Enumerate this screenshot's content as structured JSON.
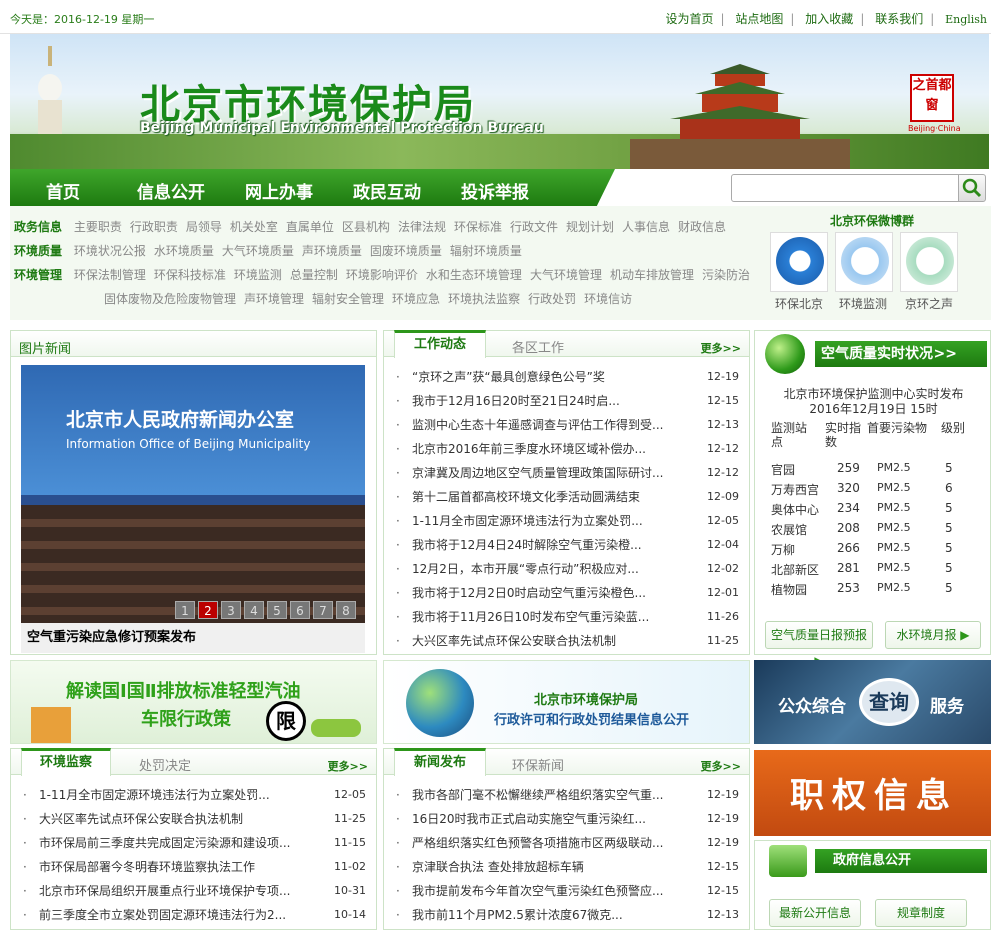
{
  "topbar": {
    "date": "今天是：2016-12-19 星期一",
    "links": [
      "设为首页",
      "站点地图",
      "加入收藏",
      "联系我们",
      "English"
    ]
  },
  "banner": {
    "title": "北京市环境保护局",
    "subtitle": "Beijing Municipal Environmental Protection Bureau",
    "seal": "之首都窗",
    "seal_sub": "Beijing·China"
  },
  "nav": [
    "首页",
    "信息公开",
    "网上办事",
    "政民互动",
    "投诉举报"
  ],
  "search": {
    "placeholder": ""
  },
  "submenu": {
    "row1": {
      "label": "政务信息",
      "items": [
        "主要职责",
        "行政职责",
        "局领导",
        "机关处室",
        "直属单位",
        "区县机构",
        "法律法规",
        "环保标准",
        "行政文件",
        "规划计划",
        "人事信息",
        "财政信息"
      ]
    },
    "row2": {
      "label": "环境质量",
      "items": [
        "环境状况公报",
        "水环境质量",
        "大气环境质量",
        "声环境质量",
        "固废环境质量",
        "辐射环境质量"
      ]
    },
    "row3": {
      "label": "环境管理",
      "items": [
        "环保法制管理",
        "环保科技标准",
        "环境监测",
        "总量控制",
        "环境影响评价",
        "水和生态环境管理",
        "大气环境管理",
        "机动车排放管理",
        "污染防治"
      ]
    },
    "row4": {
      "items": [
        "固体废物及危险废物管理",
        "声环境管理",
        "辐射安全管理",
        "环境应急",
        "环境执法监察",
        "行政处罚",
        "环境信访"
      ]
    }
  },
  "weibo": {
    "title": "北京环保微博群",
    "items": [
      "环保北京",
      "环境监测",
      "京环之声"
    ]
  },
  "photo_news": {
    "title": "图片新闻",
    "slide_title": "北京市人民政府新闻办公室",
    "slide_subtitle": "Information Office of Beijing Municipality",
    "caption": "空气重污染应急修订预案发布",
    "pages": [
      "1",
      "2",
      "3",
      "4",
      "5",
      "6",
      "7",
      "8"
    ],
    "active_page": "2"
  },
  "work": {
    "tab_active": "工作动态",
    "tab_other": "各区工作",
    "more": "更多>>",
    "items": [
      {
        "t": "“京环之声”获“最具创意绿色公号”奖",
        "d": "12-19"
      },
      {
        "t": "我市于12月16日20时至21日24时启...",
        "d": "12-15"
      },
      {
        "t": "监测中心生态十年遥感调查与评估工作得到受...",
        "d": "12-13"
      },
      {
        "t": "北京市2016年前三季度水环境区域补偿办...",
        "d": "12-12"
      },
      {
        "t": "京津冀及周边地区空气质量管理政策国际研讨...",
        "d": "12-12"
      },
      {
        "t": "第十二届首都高校环境文化季活动圆满结束",
        "d": "12-09"
      },
      {
        "t": "1-11月全市固定源环境违法行为立案处罚...",
        "d": "12-05"
      },
      {
        "t": "我市将于12月4日24时解除空气重污染橙...",
        "d": "12-04"
      },
      {
        "t": "12月2日，本市开展“零点行动”积极应对...",
        "d": "12-02"
      },
      {
        "t": "我市将于12月2日0时启动空气重污染橙色...",
        "d": "12-01"
      },
      {
        "t": "我市将于11月26日10时发布空气重污染蓝...",
        "d": "11-26"
      },
      {
        "t": "大兴区率先试点环保公安联合执法机制",
        "d": "11-25"
      }
    ]
  },
  "aq": {
    "title": "空气质量实时状况",
    "more": ">>",
    "center": "北京市环境保护监测中心实时发布",
    "time": "2016年12月19日 15时",
    "cols": [
      "监测站点",
      "实时指数",
      "首要污染物",
      "级别"
    ],
    "rows": [
      {
        "s": "官园",
        "v": "259",
        "p": "PM2.5",
        "l": "5"
      },
      {
        "s": "万寿西宫",
        "v": "320",
        "p": "PM2.5",
        "l": "6"
      },
      {
        "s": "奥体中心",
        "v": "234",
        "p": "PM2.5",
        "l": "5"
      },
      {
        "s": "农展馆",
        "v": "208",
        "p": "PM2.5",
        "l": "5"
      },
      {
        "s": "万柳",
        "v": "266",
        "p": "PM2.5",
        "l": "5"
      },
      {
        "s": "北部新区",
        "v": "281",
        "p": "PM2.5",
        "l": "5"
      },
      {
        "s": "植物园",
        "v": "253",
        "p": "PM2.5",
        "l": "5"
      }
    ],
    "btn1": "空气质量日报预报",
    "btn2": "水环境月报"
  },
  "ads": {
    "ad1_line1": "解读国Ⅰ国Ⅱ排放标准轻型汽油",
    "ad1_line2": "车限行政策",
    "ad1_badge": "限",
    "ad2_line1": "北京市环境保护局",
    "ad2_line2": "行政许可和行政处罚结果信息公开",
    "ad3_left": "公众综合",
    "ad3_mid": "查询",
    "ad3_right": "服务"
  },
  "monitor": {
    "tab_active": "环境监察",
    "tab_other": "处罚决定",
    "more": "更多>>",
    "items": [
      {
        "t": "1-11月全市固定源环境违法行为立案处罚...",
        "d": "12-05"
      },
      {
        "t": "大兴区率先试点环保公安联合执法机制",
        "d": "11-25"
      },
      {
        "t": "市环保局前三季度共完成固定污染源和建设项...",
        "d": "11-15"
      },
      {
        "t": "市环保局部署今冬明春环境监察执法工作",
        "d": "11-02"
      },
      {
        "t": "北京市环保局组织开展重点行业环境保护专项...",
        "d": "10-31"
      },
      {
        "t": "前三季度全市立案处罚固定源环境违法行为2...",
        "d": "10-14"
      }
    ]
  },
  "press": {
    "tab_active": "新闻发布",
    "tab_other": "环保新闻",
    "more": "更多>>",
    "items": [
      {
        "t": "我市各部门毫不松懈继续严格组织落实空气重...",
        "d": "12-19"
      },
      {
        "t": "16日20时我市正式启动实施空气重污染红...",
        "d": "12-19"
      },
      {
        "t": "严格组织落实红色预警各项措施市区两级联动...",
        "d": "12-19"
      },
      {
        "t": "京津联合执法 查处排放超标车辆",
        "d": "12-15"
      },
      {
        "t": "我市提前发布今年首次空气重污染红色预警应...",
        "d": "12-15"
      },
      {
        "t": "我市前11个月PM2.5累计浓度67微克...",
        "d": "12-13"
      }
    ]
  },
  "right_bottom": {
    "duty": "职权信息",
    "gov_title": "政府信息公开",
    "btn1": "最新公开信息",
    "btn2": "规章制度"
  }
}
